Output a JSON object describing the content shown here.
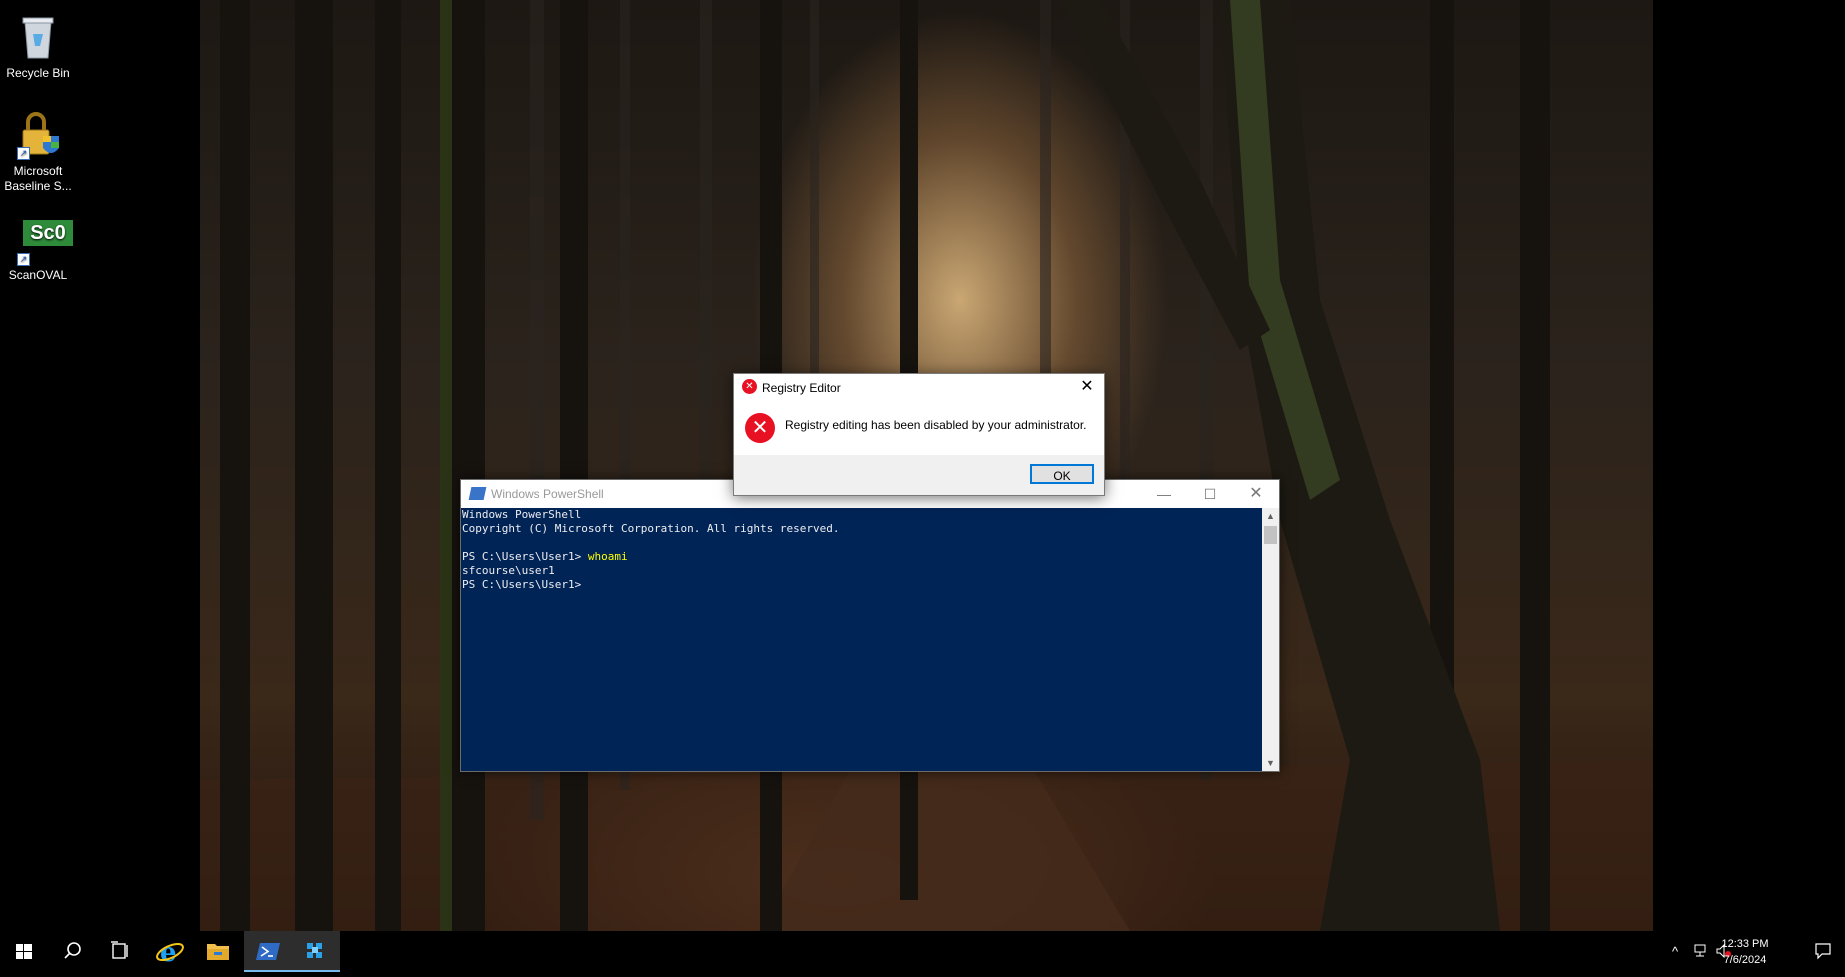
{
  "desktop": {
    "icons": [
      {
        "label": "Recycle Bin",
        "icon": "recycle-bin-icon"
      },
      {
        "label": "Microsoft Baseline S...",
        "icon": "security-baseline-icon"
      },
      {
        "label": "ScanOVAL",
        "icon": "scanoval-icon",
        "badge": "Sc0"
      }
    ]
  },
  "powershell": {
    "title": "Windows PowerShell",
    "lines": [
      "Windows PowerShell",
      "Copyright (C) Microsoft Corporation. All rights reserved.",
      "",
      "PS C:\\Users\\User1> ",
      "sfcourse\\user1",
      "PS C:\\Users\\User1>"
    ],
    "command": "whoami",
    "console_bg": "#012456"
  },
  "dialog": {
    "title": "Registry Editor",
    "message": "Registry editing has been disabled by your administrator.",
    "ok_label": "OK"
  },
  "taskbar": {
    "items": [
      "start-icon",
      "search-icon",
      "task-view-icon",
      "internet-explorer-icon",
      "file-explorer-icon",
      "powershell-icon",
      "regedit-icon"
    ],
    "active_item": "regedit-icon",
    "time": "12:33 PM",
    "date": "7/6/2024"
  },
  "colors": {
    "accent": "#76b9ed",
    "error": "#e81123"
  }
}
